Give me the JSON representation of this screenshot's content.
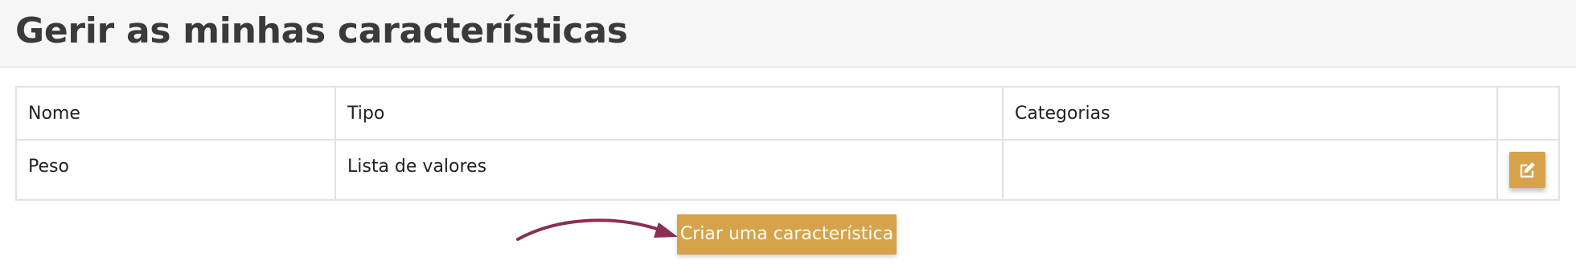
{
  "header": {
    "title": "Gerir as minhas características"
  },
  "table": {
    "columns": [
      "Nome",
      "Tipo",
      "Categorias",
      ""
    ],
    "rows": [
      {
        "nome": "Peso",
        "tipo": "Lista de valores",
        "categorias": ""
      }
    ]
  },
  "actions": {
    "create_label": "Criar uma característica",
    "edit_icon": "edit-icon"
  },
  "colors": {
    "accent": "#d6a24a",
    "arrow": "#8b2d55",
    "header_bg": "#f6f6f6"
  }
}
